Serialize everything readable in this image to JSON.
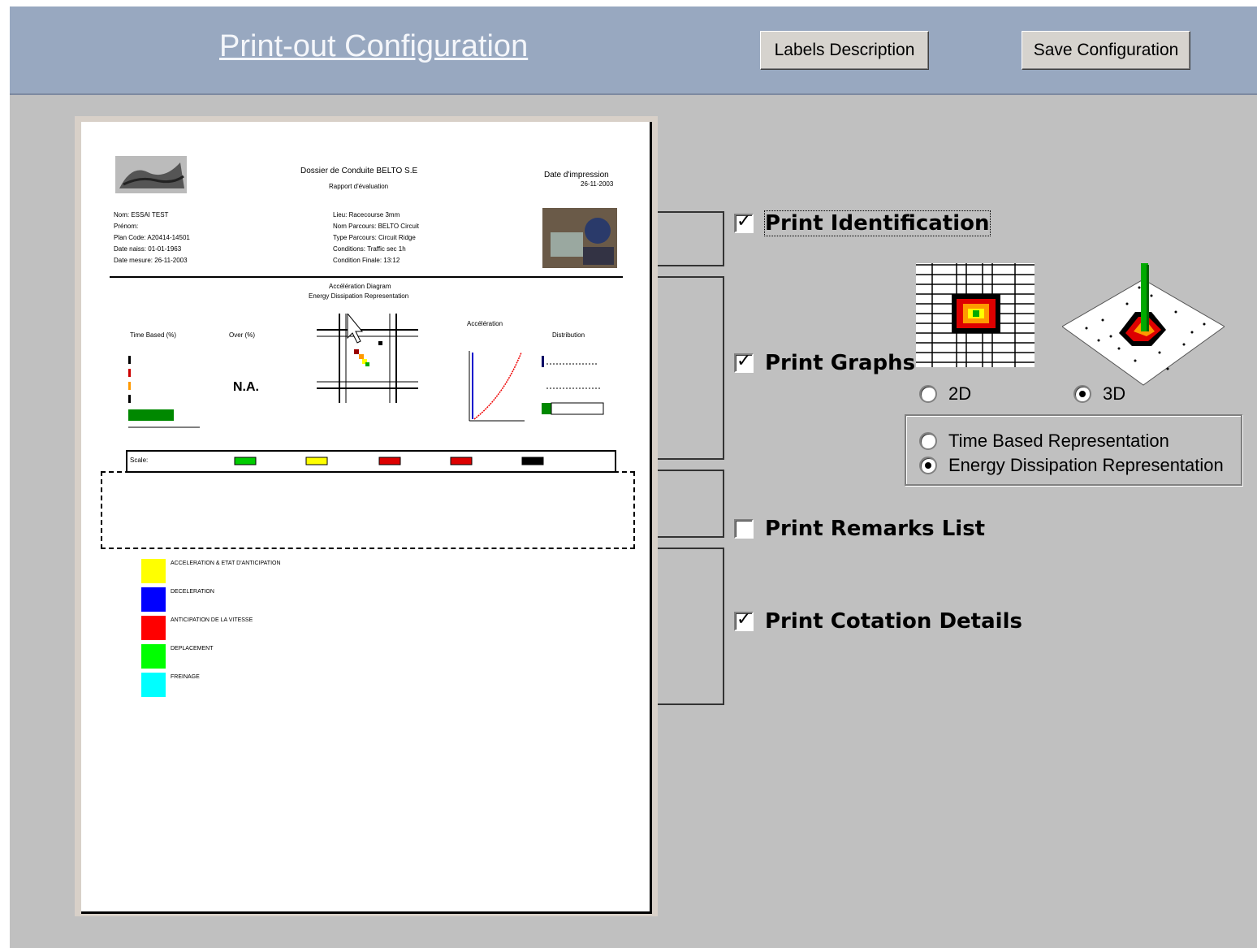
{
  "header": {
    "title": "Print-out Configuration",
    "labels_button": "Labels Description",
    "save_button": "Save Configuration"
  },
  "preview": {
    "doc_title": "Dossier de Conduite BELTO S.E",
    "doc_subtitle": "Rapport d'évaluation",
    "print_date_label": "Date d'impression",
    "print_date": "26-11-2003",
    "id_left": [
      "Nom: ESSAI TEST",
      "Prénom:",
      "Plan Code: A20414-14501",
      "Date naiss: 01-01-1963",
      "Date mesure: 26-11-2003"
    ],
    "id_right": [
      "Lieu: Racecourse 3mm",
      "Nom Parcours: BELTO Circuit",
      "Type Parcours: Circuit Ridge",
      "Conditions: Traffic sec 1h",
      "Condition Finale: 13:12"
    ],
    "graph_title": "Accélération Diagram",
    "graph_subtitle": "Energy Dissipation Representation",
    "col1_label": "Time Based (%)",
    "col2_label": "Over (%)",
    "na_text": "N.A.",
    "col4_label": "Accélération",
    "col5_label": "Distribution",
    "legend_label": "Scale:",
    "remarks_rows": [
      "ACCELERATION & ETAT D'ANTICIPATION",
      "DECELERATION",
      "ANTICIPATION DE LA VITESSE",
      "DEPLACEMENT",
      "FREINAGE"
    ]
  },
  "options": {
    "print_identification": {
      "label": "Print Identification",
      "checked": true
    },
    "print_graphs": {
      "label": "Print Graphs",
      "checked": true
    },
    "print_remarks": {
      "label": "Print Remarks List",
      "checked": false
    },
    "print_cotation": {
      "label": "Print Cotation Details",
      "checked": true
    }
  },
  "graph_mode": {
    "option_2d": "2D",
    "option_3d": "3D",
    "selected": "3D"
  },
  "representation": {
    "time_based": "Time Based Representation",
    "energy": "Energy Dissipation Representation",
    "selected": "energy"
  },
  "colors": {
    "header": "#98a8c0",
    "background": "#c0c0c0",
    "remark_colors": [
      "#ffff00",
      "#0000ff",
      "#ff0000",
      "#00ff00",
      "#00ffff"
    ]
  }
}
